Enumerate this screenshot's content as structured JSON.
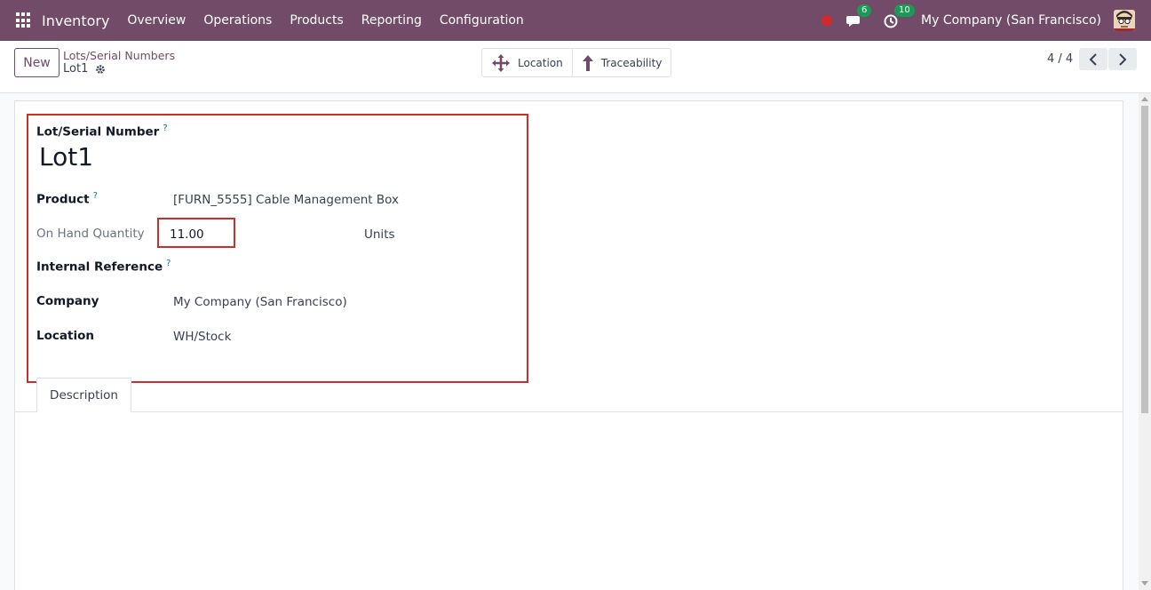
{
  "navbar": {
    "app_name": "Inventory",
    "menu": [
      "Overview",
      "Operations",
      "Products",
      "Reporting",
      "Configuration"
    ],
    "chat_count": "6",
    "activity_count": "10",
    "company": "My Company (San Francisco)",
    "brand_color": "#714B67"
  },
  "control": {
    "new_label": "New",
    "breadcrumb_parent": "Lots/Serial Numbers",
    "breadcrumb_current": "Lot1",
    "smart_buttons": {
      "location": "Location",
      "traceability": "Traceability"
    },
    "pager": "4 / 4"
  },
  "form": {
    "lot_label": "Lot/Serial Number",
    "lot_help": "?",
    "lot_value": "Lot1",
    "product_label": "Product",
    "product_help": "?",
    "product_value": "[FURN_5555] Cable Management Box",
    "qty_label": "On Hand Quantity",
    "qty_value": "11.00",
    "qty_uom": "Units",
    "internal_ref_label": "Internal Reference",
    "internal_ref_help": "?",
    "company_label": "Company",
    "company_value": "My Company (San Francisco)",
    "location_label": "Location",
    "location_value": "WH/Stock"
  },
  "tabs": {
    "description": "Description"
  },
  "icons": {
    "apps": "apps-grid-icon",
    "chat": "chat-icon",
    "activity": "clock-icon",
    "gear": "gear-icon",
    "location": "move-arrows-icon",
    "traceability": "arrow-up-icon",
    "prev": "chevron-left-icon",
    "next": "chevron-right-icon"
  },
  "highlight_color": "#c9302c"
}
